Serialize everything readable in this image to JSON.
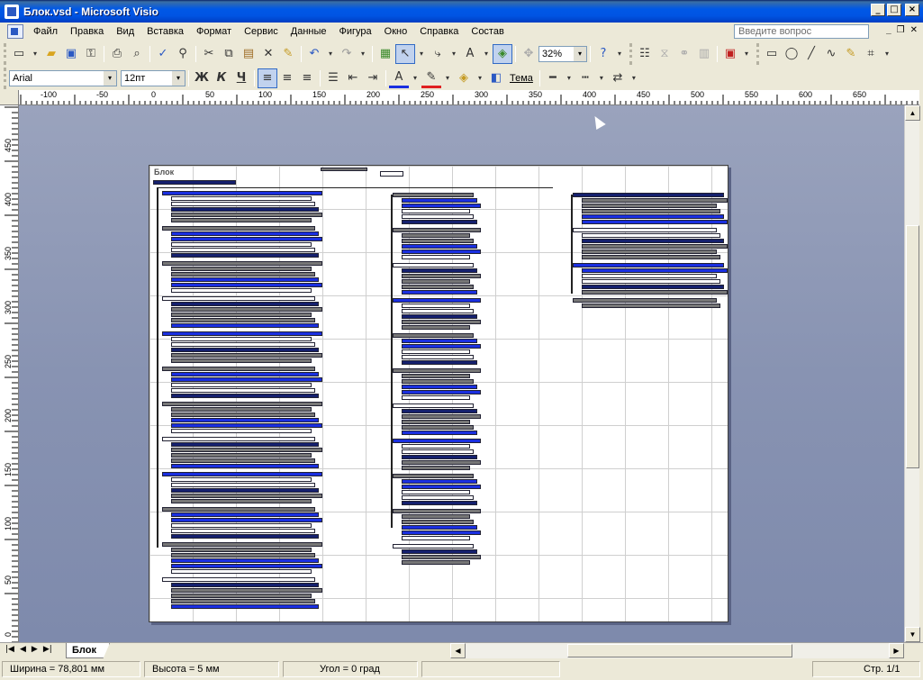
{
  "window": {
    "title": "Блок.vsd - Microsoft Visio",
    "minimize": "_",
    "maximize": "□",
    "close": "×"
  },
  "menu": {
    "items": [
      "Файл",
      "Правка",
      "Вид",
      "Вставка",
      "Формат",
      "Сервис",
      "Данные",
      "Фигура",
      "Окно",
      "Справка",
      "Состав"
    ],
    "help_placeholder": "Введите вопрос"
  },
  "toolbar": {
    "zoom": "32%",
    "font_name": "Arial",
    "font_size": "12пт",
    "bold": "Ж",
    "italic": "К",
    "underline": "Ч",
    "theme_label": "Тема"
  },
  "ruler": {
    "h_ticks": [
      "-100",
      "-50",
      "0",
      "50",
      "100",
      "150",
      "200",
      "250",
      "300",
      "350",
      "400",
      "450",
      "500",
      "550",
      "600",
      "650"
    ],
    "v_ticks": [
      "450",
      "400",
      "350",
      "300",
      "250",
      "200",
      "150",
      "100",
      "50",
      "0"
    ]
  },
  "drawing": {
    "page_title": "Блок"
  },
  "sheet_tab": "Блок",
  "status": {
    "width": "Ширина = 78,801 мм",
    "height": "Высота = 5 мм",
    "angle": "Угол = 0 град",
    "page": "Стр. 1/1"
  },
  "colors": {
    "title_bar": "#0054e3",
    "shape_blue": "#1a2fe0",
    "shape_dark": "#15206e",
    "canvas": "#8893b2"
  }
}
